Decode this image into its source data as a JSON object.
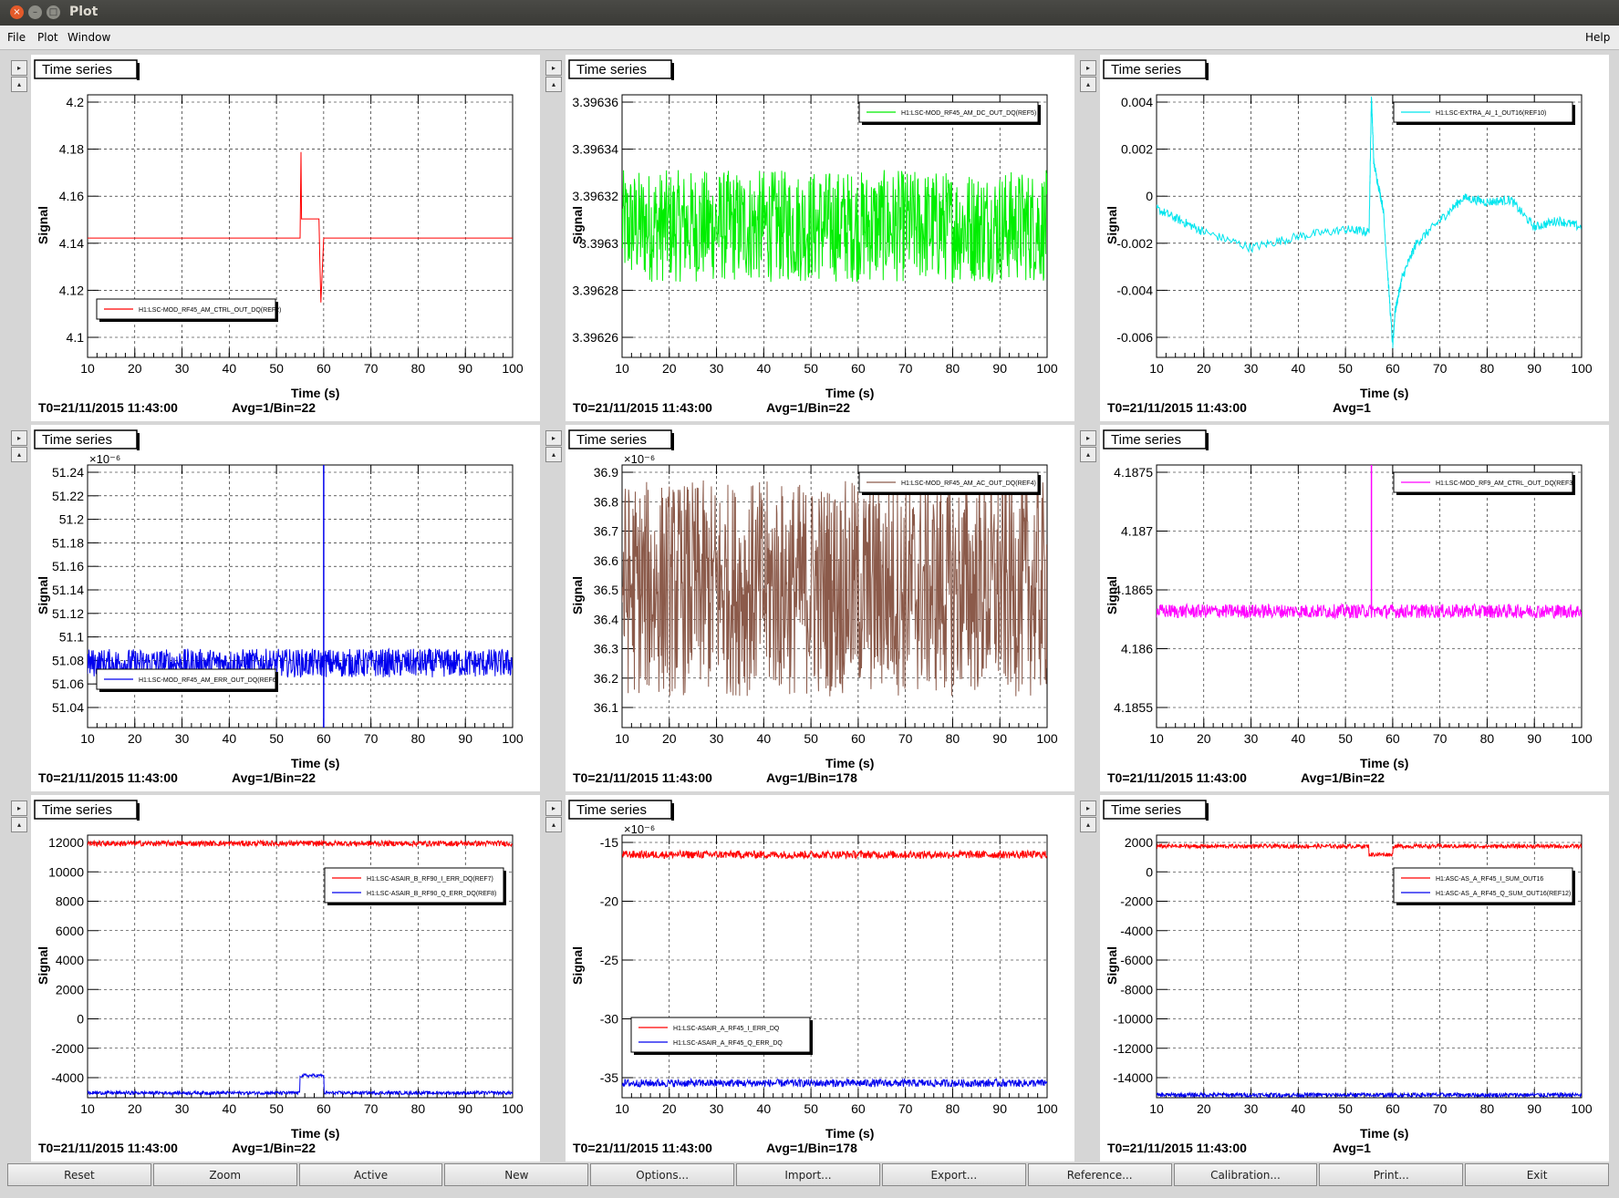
{
  "window": {
    "title": "Plot",
    "close_glyph": "×",
    "min_glyph": "–",
    "max_glyph": "□"
  },
  "menu": {
    "items": [
      "File",
      "Plot",
      "Window"
    ],
    "help": "Help"
  },
  "panels": [
    {
      "tab": "Time series",
      "t0": "T0=21/11/2015 11:43:00",
      "avg": "Avg=1/Bin=22",
      "xlabel": "Time (s)",
      "ylabel": "Signal",
      "exponent": "",
      "yticks": [
        "4.2",
        "4.18",
        "4.16",
        "4.14",
        "4.12",
        "4.1"
      ],
      "legend": [
        {
          "name": "H1:LSC-MOD_RF45_AM_CTRL_OUT_DQ(REF2)",
          "color": "#ff0000"
        }
      ]
    },
    {
      "tab": "Time series",
      "t0": "T0=21/11/2015 11:43:00",
      "avg": "Avg=1/Bin=22",
      "xlabel": "Time (s)",
      "ylabel": "Signal",
      "exponent": "",
      "yticks": [
        "3.39636",
        "3.39634",
        "3.39632",
        "3.3963",
        "3.39628",
        "3.39626"
      ],
      "legend": [
        {
          "name": "H1:LSC-MOD_RF45_AM_DC_OUT_DQ(REF5)",
          "color": "#00ee00"
        }
      ]
    },
    {
      "tab": "Time series",
      "t0": "T0=21/11/2015 11:43:00",
      "avg": "Avg=1",
      "xlabel": "Time (s)",
      "ylabel": "Signal",
      "exponent": "",
      "yticks": [
        "0.004",
        "0.002",
        "0",
        "-0.002",
        "-0.004",
        "-0.006"
      ],
      "legend": [
        {
          "name": "H1:LSC-EXTRA_AI_1_OUT16(REF10)",
          "color": "#00e5ee"
        }
      ]
    },
    {
      "tab": "Time series",
      "t0": "T0=21/11/2015 11:43:00",
      "avg": "Avg=1/Bin=22",
      "xlabel": "Time (s)",
      "ylabel": "Signal",
      "exponent": "×10⁻⁶",
      "yticks": [
        "51.24",
        "51.22",
        "51.2",
        "51.18",
        "51.16",
        "51.14",
        "51.12",
        "51.1",
        "51.08",
        "51.06",
        "51.04"
      ],
      "legend": [
        {
          "name": "H1:LSC-MOD_RF45_AM_ERR_OUT_DQ(REF6)",
          "color": "#0000ee"
        }
      ]
    },
    {
      "tab": "Time series",
      "t0": "T0=21/11/2015 11:43:00",
      "avg": "Avg=1/Bin=178",
      "xlabel": "Time (s)",
      "ylabel": "Signal",
      "exponent": "×10⁻⁶",
      "yticks": [
        "36.9",
        "36.8",
        "36.7",
        "36.6",
        "36.5",
        "36.4",
        "36.3",
        "36.2",
        "36.1"
      ],
      "legend": [
        {
          "name": "H1:LSC-MOD_RF45_AM_AC_OUT_DQ(REF4)",
          "color": "#8b5a4a"
        }
      ]
    },
    {
      "tab": "Time series",
      "t0": "T0=21/11/2015 11:43:00",
      "avg": "Avg=1/Bin=22",
      "xlabel": "Time (s)",
      "ylabel": "Signal",
      "exponent": "",
      "yticks": [
        "4.1875",
        "4.187",
        "4.1865",
        "4.186",
        "4.1855"
      ],
      "legend": [
        {
          "name": "H1:LSC-MOD_RF9_AM_CTRL_OUT_DQ(REF3)",
          "color": "#ff00ff"
        }
      ]
    },
    {
      "tab": "Time series",
      "t0": "T0=21/11/2015 11:43:00",
      "avg": "Avg=1/Bin=22",
      "xlabel": "Time (s)",
      "ylabel": "Signal",
      "exponent": "",
      "yticks": [
        "12000",
        "10000",
        "8000",
        "6000",
        "4000",
        "2000",
        "0",
        "-2000",
        "-4000"
      ],
      "legend": [
        {
          "name": "H1:LSC-ASAIR_B_RF90_I_ERR_DQ(REF7)",
          "color": "#ff0000"
        },
        {
          "name": "H1:LSC-ASAIR_B_RF90_Q_ERR_DQ(REF8)",
          "color": "#0000ee"
        }
      ]
    },
    {
      "tab": "Time series",
      "t0": "T0=21/11/2015 11:43:00",
      "avg": "Avg=1/Bin=178",
      "xlabel": "Time (s)",
      "ylabel": "Signal",
      "exponent": "×10⁻⁶",
      "yticks": [
        "-15",
        "-20",
        "-25",
        "-30",
        "-35"
      ],
      "legend": [
        {
          "name": "H1:LSC-ASAIR_A_RF45_I_ERR_DQ",
          "color": "#ff0000"
        },
        {
          "name": "H1:LSC-ASAIR_A_RF45_Q_ERR_DQ",
          "color": "#0000ee"
        }
      ]
    },
    {
      "tab": "Time series",
      "t0": "T0=21/11/2015 11:43:00",
      "avg": "Avg=1",
      "xlabel": "Time (s)",
      "ylabel": "Signal",
      "exponent": "",
      "yticks": [
        "2000",
        "0",
        "-2000",
        "-4000",
        "-6000",
        "-8000",
        "-10000",
        "-12000",
        "-14000"
      ],
      "legend": [
        {
          "name": "H1:ASC-AS_A_RF45_I_SUM_OUT16",
          "color": "#ff0000"
        },
        {
          "name": "H1:ASC-AS_A_RF45_Q_SUM_OUT16(REF12)",
          "color": "#0000ee"
        }
      ]
    }
  ],
  "xticks": [
    "10",
    "20",
    "30",
    "40",
    "50",
    "60",
    "70",
    "80",
    "90",
    "100"
  ],
  "chart_data": [
    {
      "type": "line",
      "title": "Time series",
      "xlabel": "Time (s)",
      "ylabel": "Signal",
      "xlim": [
        10,
        100
      ],
      "ylim": [
        4.09,
        4.2
      ],
      "series": [
        {
          "name": "H1:LSC-MOD_RF45_AM_CTRL_OUT_DQ(REF2)",
          "color": "#ff0000",
          "x": [
            10,
            55,
            55.2,
            55.3,
            59,
            59.2,
            59.4,
            60,
            100
          ],
          "y": [
            4.14,
            4.14,
            4.176,
            4.148,
            4.148,
            4.13,
            4.113,
            4.14,
            4.14
          ]
        }
      ]
    },
    {
      "type": "line",
      "title": "Time series",
      "xlabel": "Time (s)",
      "ylabel": "Signal",
      "xlim": [
        10,
        100
      ],
      "ylim": [
        3.39624,
        3.39638
      ],
      "series": [
        {
          "name": "H1:LSC-MOD_RF45_AM_DC_OUT_DQ(REF5)",
          "color": "#00ee00",
          "mean": 3.39631,
          "noise": 3e-05
        }
      ]
    },
    {
      "type": "line",
      "title": "Time series",
      "xlabel": "Time (s)",
      "ylabel": "Signal",
      "xlim": [
        10,
        100
      ],
      "ylim": [
        -0.0065,
        0.005
      ],
      "series": [
        {
          "name": "H1:LSC-EXTRA_AI_1_OUT16(REF10)",
          "color": "#00e5ee",
          "x": [
            10,
            15,
            20,
            30,
            40,
            50,
            55,
            55.5,
            56,
            58,
            60,
            60.5,
            62,
            65,
            70,
            75,
            80,
            85,
            90,
            95,
            100
          ],
          "y": [
            0,
            -0.0005,
            -0.001,
            -0.0017,
            -0.0012,
            -0.0009,
            -0.001,
            0.005,
            0.002,
            0,
            -0.006,
            -0.0045,
            -0.003,
            -0.0015,
            -0.0005,
            0.0005,
            0.0003,
            0.0004,
            -0.0008,
            -0.0005,
            -0.0008
          ]
        }
      ]
    },
    {
      "type": "line",
      "title": "Time series",
      "xlabel": "Time (s)",
      "ylabel": "Signal",
      "xlim": [
        10,
        100
      ],
      "ylim": [
        51.03,
        51.25
      ],
      "series": [
        {
          "name": "H1:LSC-MOD_RF45_AM_ERR_OUT_DQ(REF6)",
          "color": "#0000ee",
          "mean": 51.084,
          "noise": 0.012,
          "spike_x": 60,
          "spike_y": [
            51.03,
            51.25
          ]
        }
      ]
    },
    {
      "type": "line",
      "title": "Time series",
      "xlabel": "Time (s)",
      "ylabel": "Signal",
      "xlim": [
        10,
        100
      ],
      "ylim": [
        36.1,
        36.95
      ],
      "series": [
        {
          "name": "H1:LSC-MOD_RF45_AM_AC_OUT_DQ(REF4)",
          "color": "#8b5a4a",
          "mean": 36.55,
          "noise": 0.35
        }
      ]
    },
    {
      "type": "line",
      "title": "Time series",
      "xlabel": "Time (s)",
      "ylabel": "Signal",
      "xlim": [
        10,
        100
      ],
      "ylim": [
        4.185,
        4.188
      ],
      "series": [
        {
          "name": "H1:LSC-MOD_RF9_AM_CTRL_OUT_DQ(REF3)",
          "color": "#ff00ff",
          "mean": 4.18633,
          "noise": 8e-05,
          "spike_x": 55.5,
          "spike_y": [
            4.1863,
            4.188
          ]
        }
      ]
    },
    {
      "type": "line",
      "title": "Time series",
      "xlabel": "Time (s)",
      "ylabel": "Signal",
      "xlim": [
        10,
        100
      ],
      "ylim": [
        -5000,
        14000
      ],
      "series": [
        {
          "name": "H1:LSC-ASAIR_B_RF90_I_ERR_DQ(REF7)",
          "color": "#ff0000",
          "mean": 13400,
          "noise": 200
        },
        {
          "name": "H1:LSC-ASAIR_B_RF90_Q_ERR_DQ(REF8)",
          "color": "#0000ee",
          "mean": -4650,
          "noise": 120,
          "step": {
            "x": [
              55,
              60
            ],
            "y": -3400
          }
        }
      ]
    },
    {
      "type": "line",
      "title": "Time series",
      "xlabel": "Time (s)",
      "ylabel": "Signal",
      "xlim": [
        10,
        100
      ],
      "ylim": [
        -38,
        -11
      ],
      "series": [
        {
          "name": "H1:LSC-ASAIR_A_RF45_I_ERR_DQ",
          "color": "#ff0000",
          "mean": -13,
          "noise": 0.4
        },
        {
          "name": "H1:LSC-ASAIR_A_RF45_Q_ERR_DQ",
          "color": "#0000ee",
          "mean": -36.5,
          "noise": 0.4
        }
      ]
    },
    {
      "type": "line",
      "title": "Time series",
      "xlabel": "Time (s)",
      "ylabel": "Signal",
      "xlim": [
        10,
        100
      ],
      "ylim": [
        -15500,
        3500
      ],
      "series": [
        {
          "name": "H1:ASC-AS_A_RF45_I_SUM_OUT16",
          "color": "#ff0000",
          "mean": 2700,
          "noise": 150,
          "step": {
            "x": [
              55,
              60
            ],
            "y": 2100
          }
        },
        {
          "name": "H1:ASC-AS_A_RF45_Q_SUM_OUT16(REF12)",
          "color": "#0000ee",
          "mean": -15300,
          "noise": 150
        }
      ]
    }
  ],
  "buttons": [
    "Reset",
    "Zoom",
    "Active",
    "New",
    "Options...",
    "Import...",
    "Export...",
    "Reference...",
    "Calibration...",
    "Print...",
    "Exit"
  ]
}
